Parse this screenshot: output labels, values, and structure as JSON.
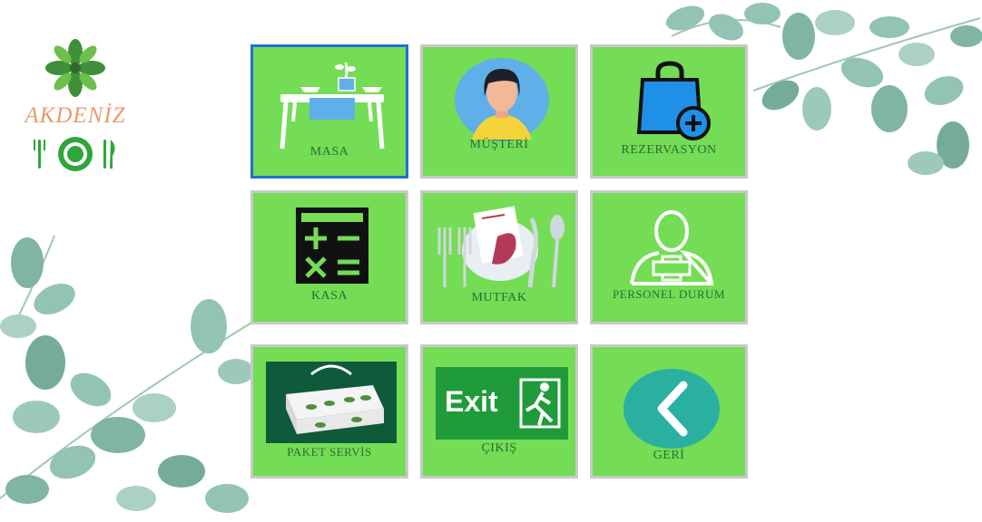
{
  "app": {
    "brand_name": "AKDENİZ",
    "colors": {
      "tile": "#74dc55",
      "tile_border": "#c9c9c9",
      "selected_border": "#1e6fd6",
      "label": "#2e6b33",
      "brand": "#e89a6c"
    }
  },
  "menu": {
    "tiles": [
      {
        "label": "MASA",
        "icon": "table-icon"
      },
      {
        "label": "MÜŞTERİ",
        "icon": "customer-avatar-icon"
      },
      {
        "label": "REZERVASYON",
        "icon": "shopping-bag-add-icon"
      },
      {
        "label": "KASA",
        "icon": "calculator-icon"
      },
      {
        "label": "MUTFAK",
        "icon": "menu-cutlery-icon"
      },
      {
        "label": "PERSONEL DURUM",
        "icon": "staff-medical-icon"
      },
      {
        "label": "PAKET SERVİS",
        "icon": "takeaway-box-icon"
      },
      {
        "label": "ÇIKIŞ",
        "icon": "exit-sign-icon"
      },
      {
        "label": "GERİ",
        "icon": "chevron-left-icon"
      }
    ],
    "exit_sign_text": "Exit"
  }
}
